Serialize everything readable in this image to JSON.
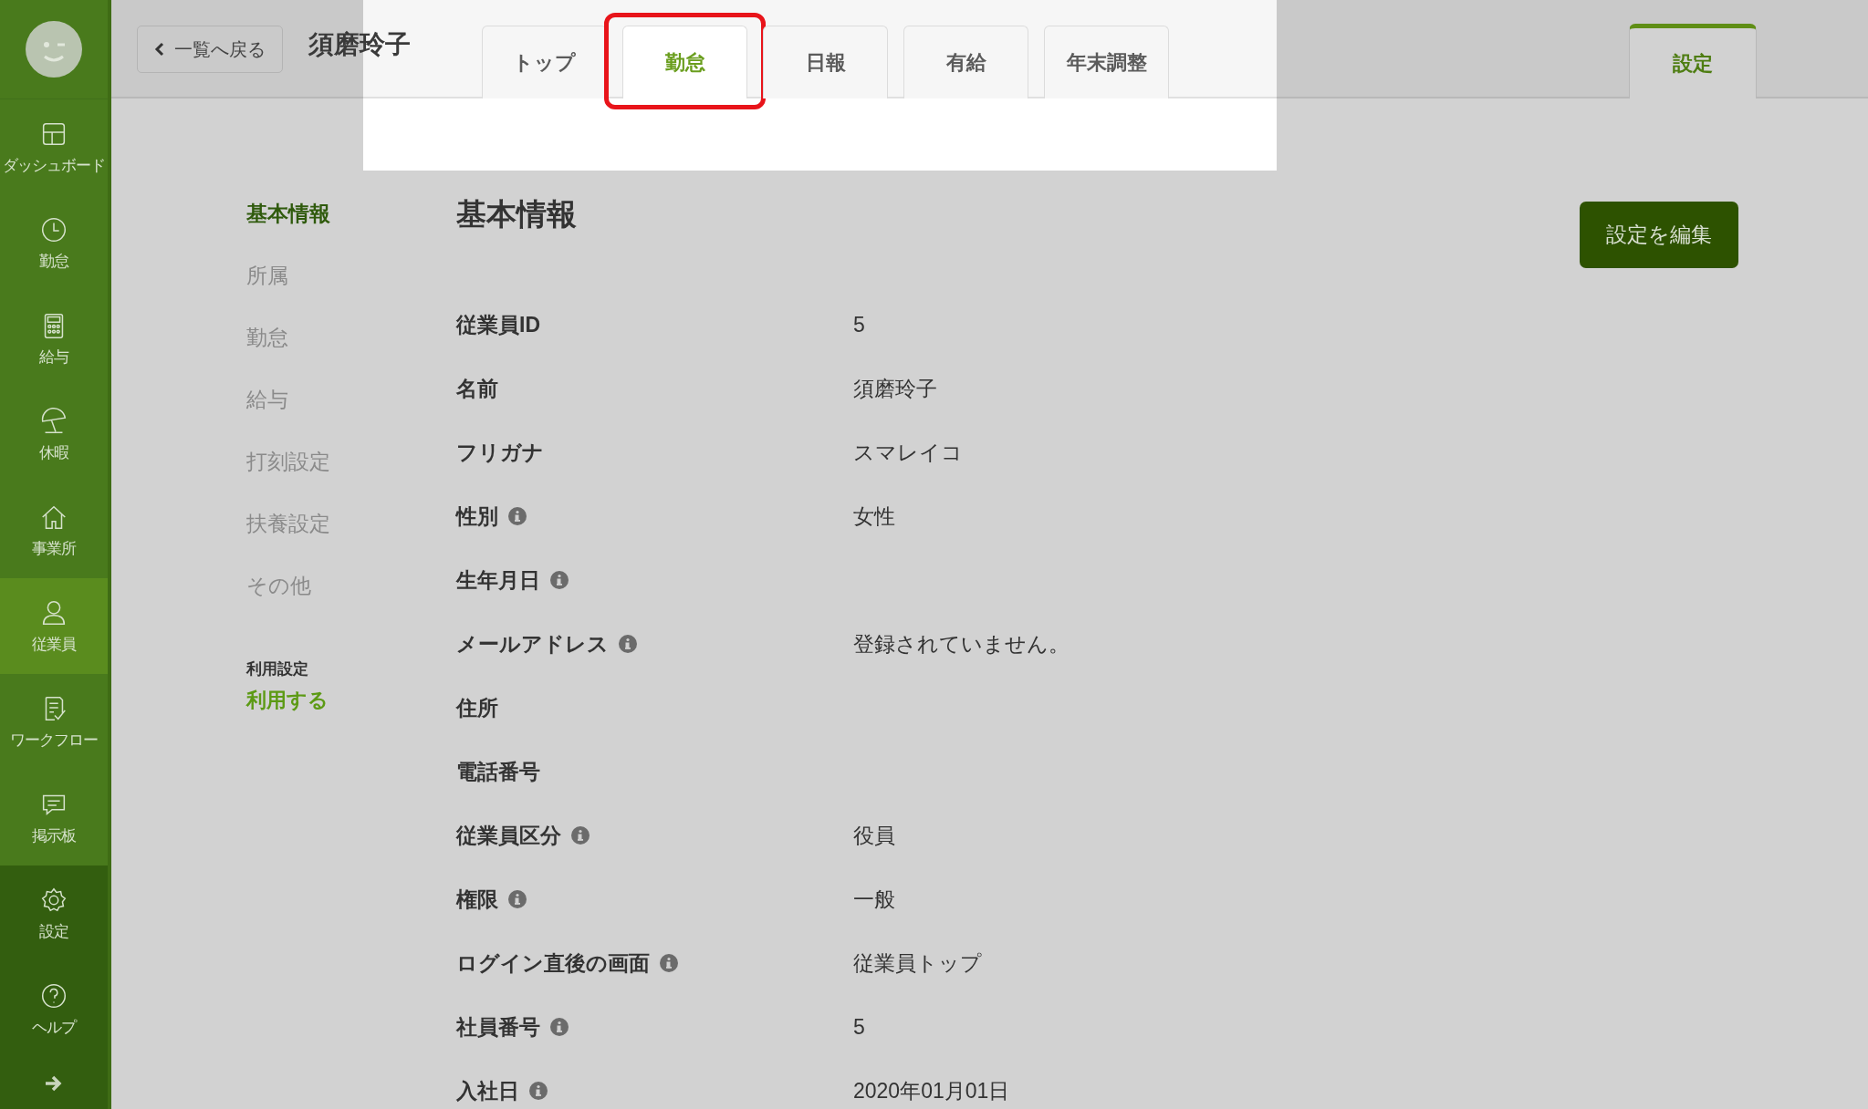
{
  "sidebar": {
    "items": [
      {
        "label": "ダッシュボード",
        "selected": false
      },
      {
        "label": "勤怠",
        "selected": false
      },
      {
        "label": "給与",
        "selected": false
      },
      {
        "label": "休暇",
        "selected": false
      },
      {
        "label": "事業所",
        "selected": false
      },
      {
        "label": "従業員",
        "selected": true
      },
      {
        "label": "ワークフロー",
        "selected": false
      },
      {
        "label": "掲示板",
        "selected": false
      }
    ],
    "bottom_items": [
      {
        "label": "設定",
        "selected": false
      },
      {
        "label": "ヘルプ",
        "selected": false
      }
    ]
  },
  "header": {
    "back_button": "一覧へ戻る",
    "employee_name": "須磨玲子",
    "tabs": [
      {
        "label": "トップ",
        "selected": false,
        "highlighted": false
      },
      {
        "label": "勤怠",
        "selected": true,
        "highlighted": true
      },
      {
        "label": "日報",
        "selected": false,
        "highlighted": false
      },
      {
        "label": "有給",
        "selected": false,
        "highlighted": false
      },
      {
        "label": "年末調整",
        "selected": false,
        "highlighted": false
      }
    ],
    "settings_tab": {
      "label": "設定",
      "selected": true
    }
  },
  "subnav": {
    "items": [
      {
        "label": "基本情報",
        "selected": true
      },
      {
        "label": "所属",
        "selected": false
      },
      {
        "label": "勤怠",
        "selected": false
      },
      {
        "label": "給与",
        "selected": false
      },
      {
        "label": "打刻設定",
        "selected": false
      },
      {
        "label": "扶養設定",
        "selected": false
      },
      {
        "label": "その他",
        "selected": false
      }
    ],
    "usage": {
      "label": "利用設定",
      "value": "利用する"
    }
  },
  "section": {
    "title": "基本情報",
    "edit_button": "設定を編集",
    "fields": [
      {
        "label": "従業員ID",
        "info": false,
        "value": "5"
      },
      {
        "label": "名前",
        "info": false,
        "value": "須磨玲子"
      },
      {
        "label": "フリガナ",
        "info": false,
        "value": "スマレイコ"
      },
      {
        "label": "性別",
        "info": true,
        "value": "女性"
      },
      {
        "label": "生年月日",
        "info": true
      },
      {
        "label": "メールアドレス",
        "info": true,
        "value": "登録されていません。"
      },
      {
        "label": "住所",
        "info": false
      },
      {
        "label": "電話番号",
        "info": false
      },
      {
        "label": "従業員区分",
        "info": true,
        "value": "役員"
      },
      {
        "label": "権限",
        "info": true,
        "value": "一般"
      },
      {
        "label": "ログイン直後の画面",
        "info": true,
        "value": "従業員トップ"
      },
      {
        "label": "社員番号",
        "info": true,
        "value": "5"
      },
      {
        "label": "入社日",
        "info": true,
        "value": "2020年01月01日"
      }
    ]
  }
}
